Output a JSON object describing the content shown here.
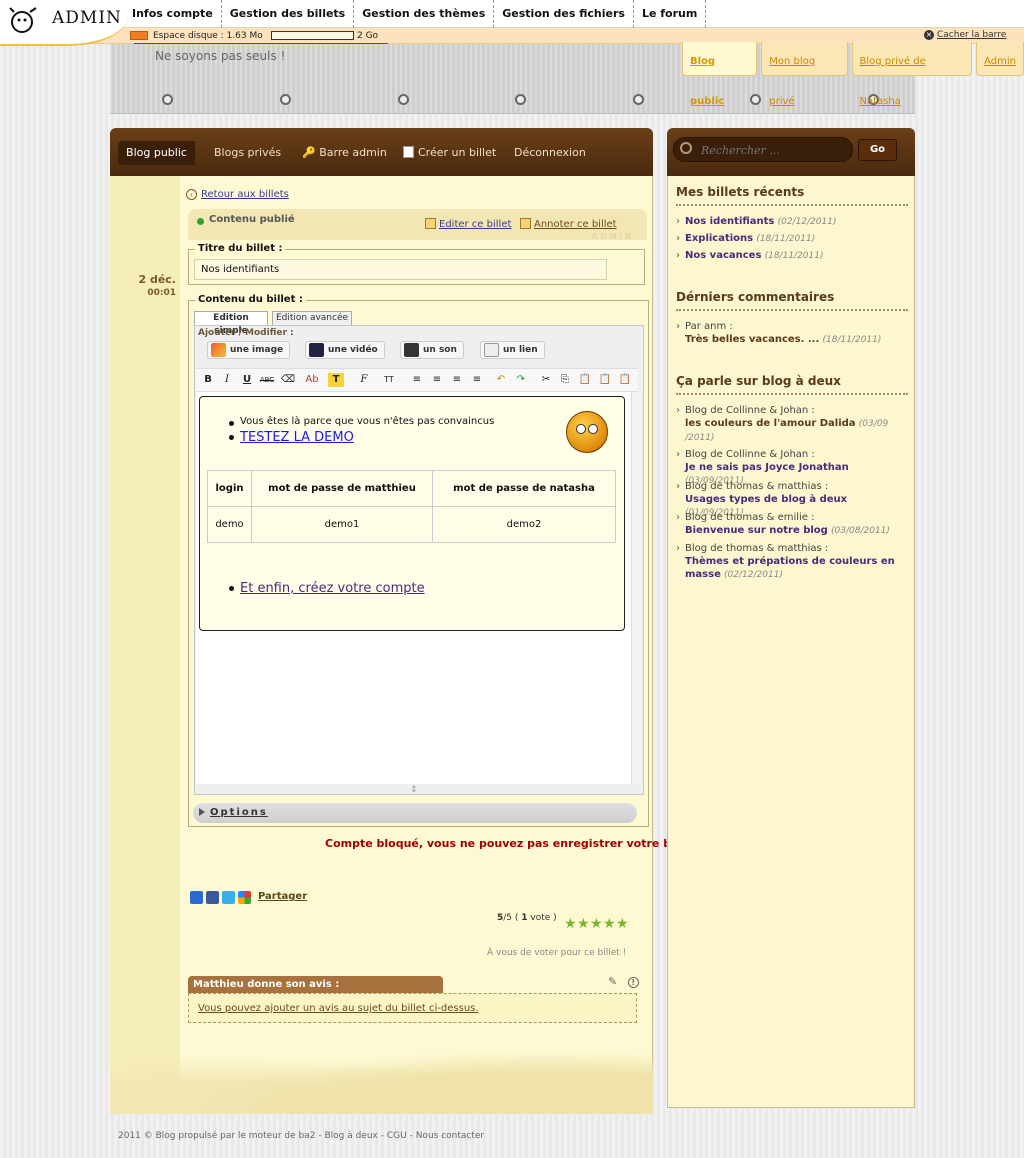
{
  "admin_bar": {
    "logo_text": "ADMIN",
    "nav": [
      "Infos compte",
      "Gestion des billets",
      "Gestion des thèmes",
      "Gestion des fichiers",
      "Le forum"
    ],
    "disk_label": "Espace disque : 1.63 Mo",
    "disk_max": "2 Go",
    "disk_used_fraction": 0.0008,
    "hide_label": "Cacher la barre"
  },
  "header": {
    "slogan": "Ne soyons pas seuls !",
    "blog_tabs": [
      "Blog public",
      "Mon blog privé",
      "Blog privé de Natasha",
      "Admin"
    ]
  },
  "main_nav": {
    "items": [
      "Blog public",
      "Blogs privés",
      "Barre admin",
      "Créer un billet",
      "Déconnexion"
    ]
  },
  "post": {
    "date": "2 déc.",
    "time": "00:01",
    "back": "Retour aux billets",
    "status": "Contenu publié",
    "edit": "Editer ce billet",
    "annotate": "Annoter ce billet",
    "watermark": "ADMIN",
    "title_legend": "Titre du billet :",
    "title_value": "Nos identifiants",
    "body_legend": "Contenu du billet :",
    "editor_tabs": [
      "Edition simple",
      "Edition avancée"
    ],
    "add_label": "Ajouter / Modifier :",
    "media_buttons": [
      "une image",
      "une vidéo",
      "un son",
      "un lien"
    ],
    "content": {
      "bullet1": "Vous êtes là parce que vous n'êtes pas convaincus",
      "bullet2": "TESTEZ LA DEMO",
      "table_headers": [
        "login",
        "mot de passe de matthieu",
        "mot de passe de natasha"
      ],
      "table_row": [
        "demo",
        "demo1",
        "demo2"
      ],
      "bullet3": "Et enfin, créez votre compte"
    },
    "options": "Options",
    "blocked": "Compte bloqué, vous ne pouvez pas enregistrer votre billet",
    "share": "Partager",
    "rating_score": "5",
    "rating_max": "/5 (",
    "rating_votes": "1",
    "rating_suffix": "vote )",
    "stars": 5,
    "vote_hint": "À vous de voter pour ce billet !",
    "avis_title": "Matthieu donne son avis :",
    "avis_text": "Vous pouvez ajouter un avis au sujet du billet ci-dessus."
  },
  "sidebar": {
    "search_placeholder": "Rechercher ...",
    "go": "Go",
    "recent_title": "Mes billets récents",
    "recent": [
      {
        "title": "Nos identifiants",
        "date": "(02/12/2011)"
      },
      {
        "title": "Explications",
        "date": "(18/11/2011)"
      },
      {
        "title": "Nos vacances",
        "date": "(18/11/2011)"
      }
    ],
    "comments_title": "Dérniers commentaires",
    "comment": {
      "author": "Par anm :",
      "text": "Très belles vacances. ...",
      "date": "(18/11/2011)"
    },
    "talk_title": "Ça parle sur blog à deux",
    "talk": [
      {
        "blog": "Blog de Collinne & Johan :",
        "title": "les couleurs de l'amour Dalida",
        "date": "(03/09 /2011)",
        "style": "strong"
      },
      {
        "blog": "Blog de Collinne & Johan :",
        "title": "Je ne sais pas Joyce Jonathan",
        "date": "(03/09/2011)",
        "style": "link"
      },
      {
        "blog": "Blog de thomas & matthias :",
        "title": "Usages types de blog à deux",
        "date": "(01/09/2011)",
        "style": "link"
      },
      {
        "blog": "Blog de thomas & emilie :",
        "title": "Bienvenue sur notre blog",
        "date": "(03/08/2011)",
        "style": "link"
      },
      {
        "blog": "Blog de thomas & matthias :",
        "title": "Thèmes et prépations de couleurs en masse",
        "date": "(02/12/2011)",
        "style": "link"
      }
    ]
  },
  "footer": {
    "text": "2011 © Blog propulsé par le moteur de ba2 -",
    "links": [
      "Blog à deux",
      "CGU",
      "Nous contacter"
    ]
  },
  "colors": {
    "brown": "#4a2a0e",
    "cream": "#fdf9d3",
    "accent": "#d39a00",
    "error": "#a00000",
    "link": "#4a2a7a"
  }
}
